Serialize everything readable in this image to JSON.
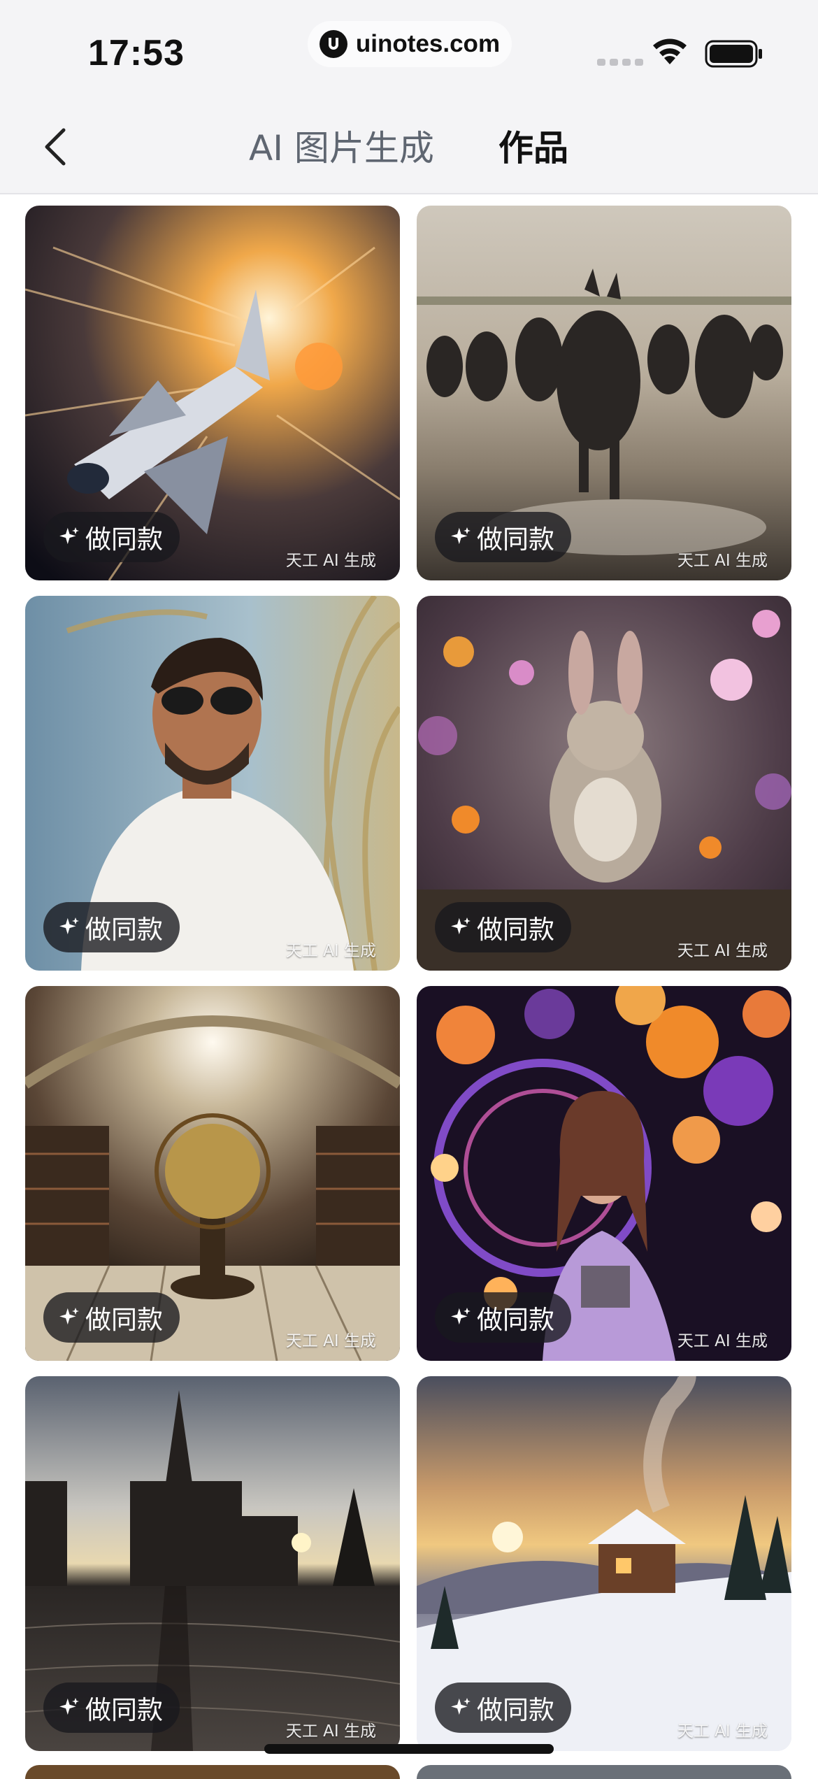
{
  "status": {
    "time": "17:53",
    "url": "uinotes.com"
  },
  "nav": {
    "tabs": [
      {
        "label": "AI 图片生成",
        "active": false
      },
      {
        "label": "作品",
        "active": true
      }
    ]
  },
  "cards": [
    {
      "subject": "space shuttle",
      "button": "做同款",
      "watermark": "天工 AI 生成"
    },
    {
      "subject": "stampeding horses",
      "button": "做同款",
      "watermark": "天工 AI 生成"
    },
    {
      "subject": "man with sunglasses",
      "button": "做同款",
      "watermark": "天工 AI 生成"
    },
    {
      "subject": "leaping rabbit",
      "button": "做同款",
      "watermark": "天工 AI 生成"
    },
    {
      "subject": "library globe",
      "button": "做同款",
      "watermark": "天工 AI 生成"
    },
    {
      "subject": "woman with balloons",
      "button": "做同款",
      "watermark": "天工 AI 生成"
    },
    {
      "subject": "cathedral at sunset",
      "button": "做同款",
      "watermark": "天工 AI 生成"
    },
    {
      "subject": "snowy cabin",
      "button": "做同款",
      "watermark": "天工 AI 生成"
    }
  ],
  "colors": {
    "background": "#ffffff",
    "nav_background": "#f4f4f6",
    "button_background": "#18181e",
    "active_tab": "#111111",
    "inactive_tab": "#5f6671"
  }
}
